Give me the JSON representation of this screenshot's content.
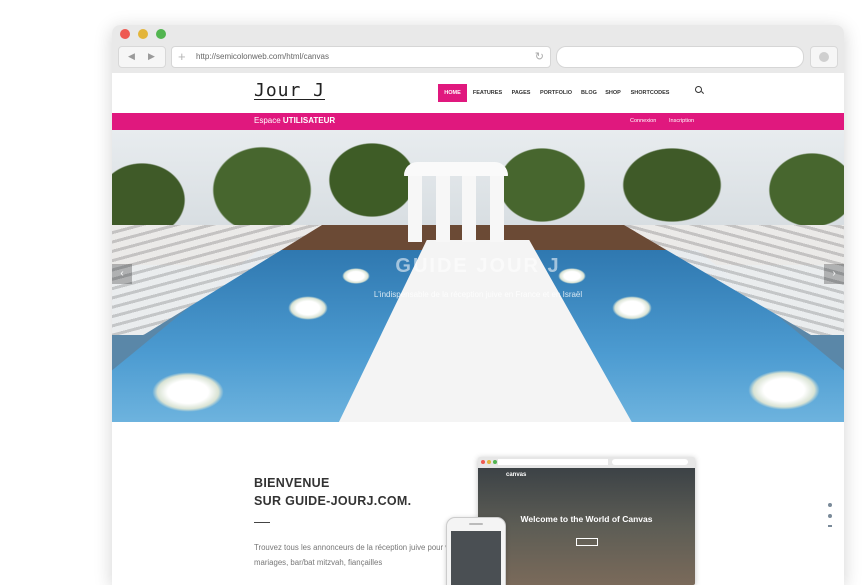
{
  "browser": {
    "url": "http://semicolonweb.com/html/canvas",
    "back_glyph": "◀",
    "forward_glyph": "▶",
    "new_tab_glyph": "+",
    "reload_glyph": "↻"
  },
  "site": {
    "logo": "Jour J",
    "menu": [
      {
        "label": "HOME",
        "active": true
      },
      {
        "label": "FEATURES",
        "active": false
      },
      {
        "label": "PAGES",
        "active": false
      },
      {
        "label": "PORTFOLIO",
        "active": false
      },
      {
        "label": "BLOG",
        "active": false
      },
      {
        "label": "SHOP",
        "active": false
      },
      {
        "label": "SHORTCODES",
        "active": false
      }
    ],
    "colors": {
      "accent": "#e0187e"
    }
  },
  "userbar": {
    "prefix": "Espace ",
    "strong": "UTILISATEUR",
    "login": "Connexion",
    "register": "Inscription"
  },
  "hero": {
    "title": "GUIDE JOUR J",
    "subtitle": "L'indispensable de la réception juive en France et en Israël",
    "prev_glyph": "‹",
    "next_glyph": "›"
  },
  "content": {
    "welcome_line1": "BIENVENUE",
    "welcome_line2": "SUR GUIDE-JOURJ.COM.",
    "paragraph": "Trouvez tous les annonceurs de la réception juive pour vos mariages, bar/bat mitzvah, fiançailles"
  },
  "mockup": {
    "brand": "canvas",
    "title": "Welcome to the World of Canvas"
  }
}
